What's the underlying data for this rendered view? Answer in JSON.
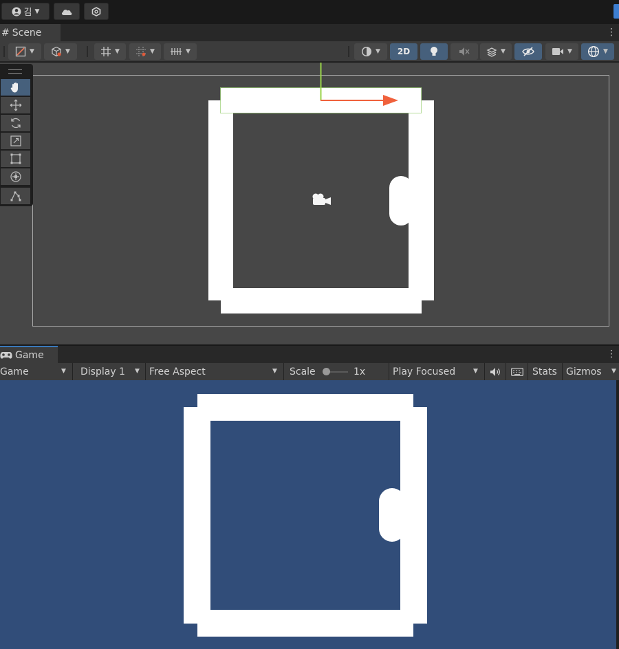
{
  "topbar": {
    "account_glyph": "김",
    "icons": [
      "account-icon",
      "cloud-icon",
      "collab-icon"
    ]
  },
  "scene": {
    "tab_label": "Scene",
    "toggle_2d_label": "2D",
    "tools": [
      "hand-tool",
      "move-tool",
      "rotate-tool",
      "scale-tool",
      "rect-tool",
      "transform-tool",
      "custom-editor-tool"
    ]
  },
  "game": {
    "tab_label": "Game",
    "view_mode": "Game",
    "display": "Display 1",
    "aspect": "Free Aspect",
    "scale_label": "Scale",
    "scale_value": "1x",
    "play_mode": "Play Focused",
    "stats_label": "Stats",
    "gizmos_label": "Gizmos",
    "background_color": "#314d79"
  },
  "colors": {
    "accent": "#46607c",
    "scene_bg": "#474747",
    "panel_bg": "#3c3c3c",
    "sprite_white": "#ffffff",
    "gizmo_x": "#f0613c",
    "gizmo_y": "#99d34a"
  }
}
